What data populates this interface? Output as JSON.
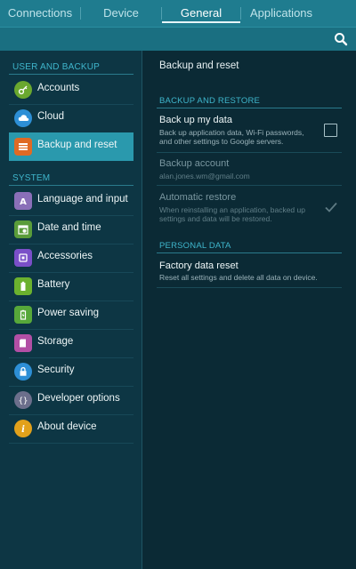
{
  "tabs": [
    {
      "label": "Connections",
      "active": false
    },
    {
      "label": "Device",
      "active": false
    },
    {
      "label": "General",
      "active": true
    },
    {
      "label": "Applications",
      "active": false
    }
  ],
  "colors": {
    "accent": "#2a99ad",
    "header": "#3fb6cc",
    "background": "#0b2a35"
  },
  "left": {
    "section1": "USER AND BACKUP",
    "section2": "SYSTEM",
    "items": [
      {
        "label": "Accounts",
        "icon": "key-icon",
        "color": "#6aa82f"
      },
      {
        "label": "Cloud",
        "icon": "cloud-icon",
        "color": "#2d8fd6"
      },
      {
        "label": "Backup and reset",
        "icon": "backup-icon",
        "color": "#e06a24"
      },
      {
        "label": "Language and input",
        "icon": "language-icon",
        "color": "#8a6fb8"
      },
      {
        "label": "Date and time",
        "icon": "calendar-icon",
        "color": "#5a9c3a"
      },
      {
        "label": "Accessories",
        "icon": "accessories-icon",
        "color": "#7a4fc8"
      },
      {
        "label": "Battery",
        "icon": "battery-icon",
        "color": "#6bb12e"
      },
      {
        "label": "Power saving",
        "icon": "power-saving-icon",
        "color": "#57a83a"
      },
      {
        "label": "Storage",
        "icon": "storage-icon",
        "color": "#b24fa5"
      },
      {
        "label": "Security",
        "icon": "lock-icon",
        "color": "#2d8fd6"
      },
      {
        "label": "Developer options",
        "icon": "developer-icon",
        "color": "#6c6f8c"
      },
      {
        "label": "About device",
        "icon": "info-icon",
        "color": "#e2a11b"
      }
    ]
  },
  "right": {
    "title": "Backup and reset",
    "section1": "BACKUP AND RESTORE",
    "backup_title": "Back up my data",
    "backup_sub1": "Back up application data, Wi-Fi passwords,",
    "backup_sub2": "and other settings to Google servers.",
    "account_title": "Backup account",
    "account_value": "alan.jones.wm@gmail.com",
    "restore_title": "Automatic restore",
    "restore_sub1": "When reinstalling an application, backed up",
    "restore_sub2": "settings and data will be restored.",
    "section2": "PERSONAL DATA",
    "factory_title": "Factory data reset",
    "factory_sub": "Reset all settings and delete all data on device."
  }
}
